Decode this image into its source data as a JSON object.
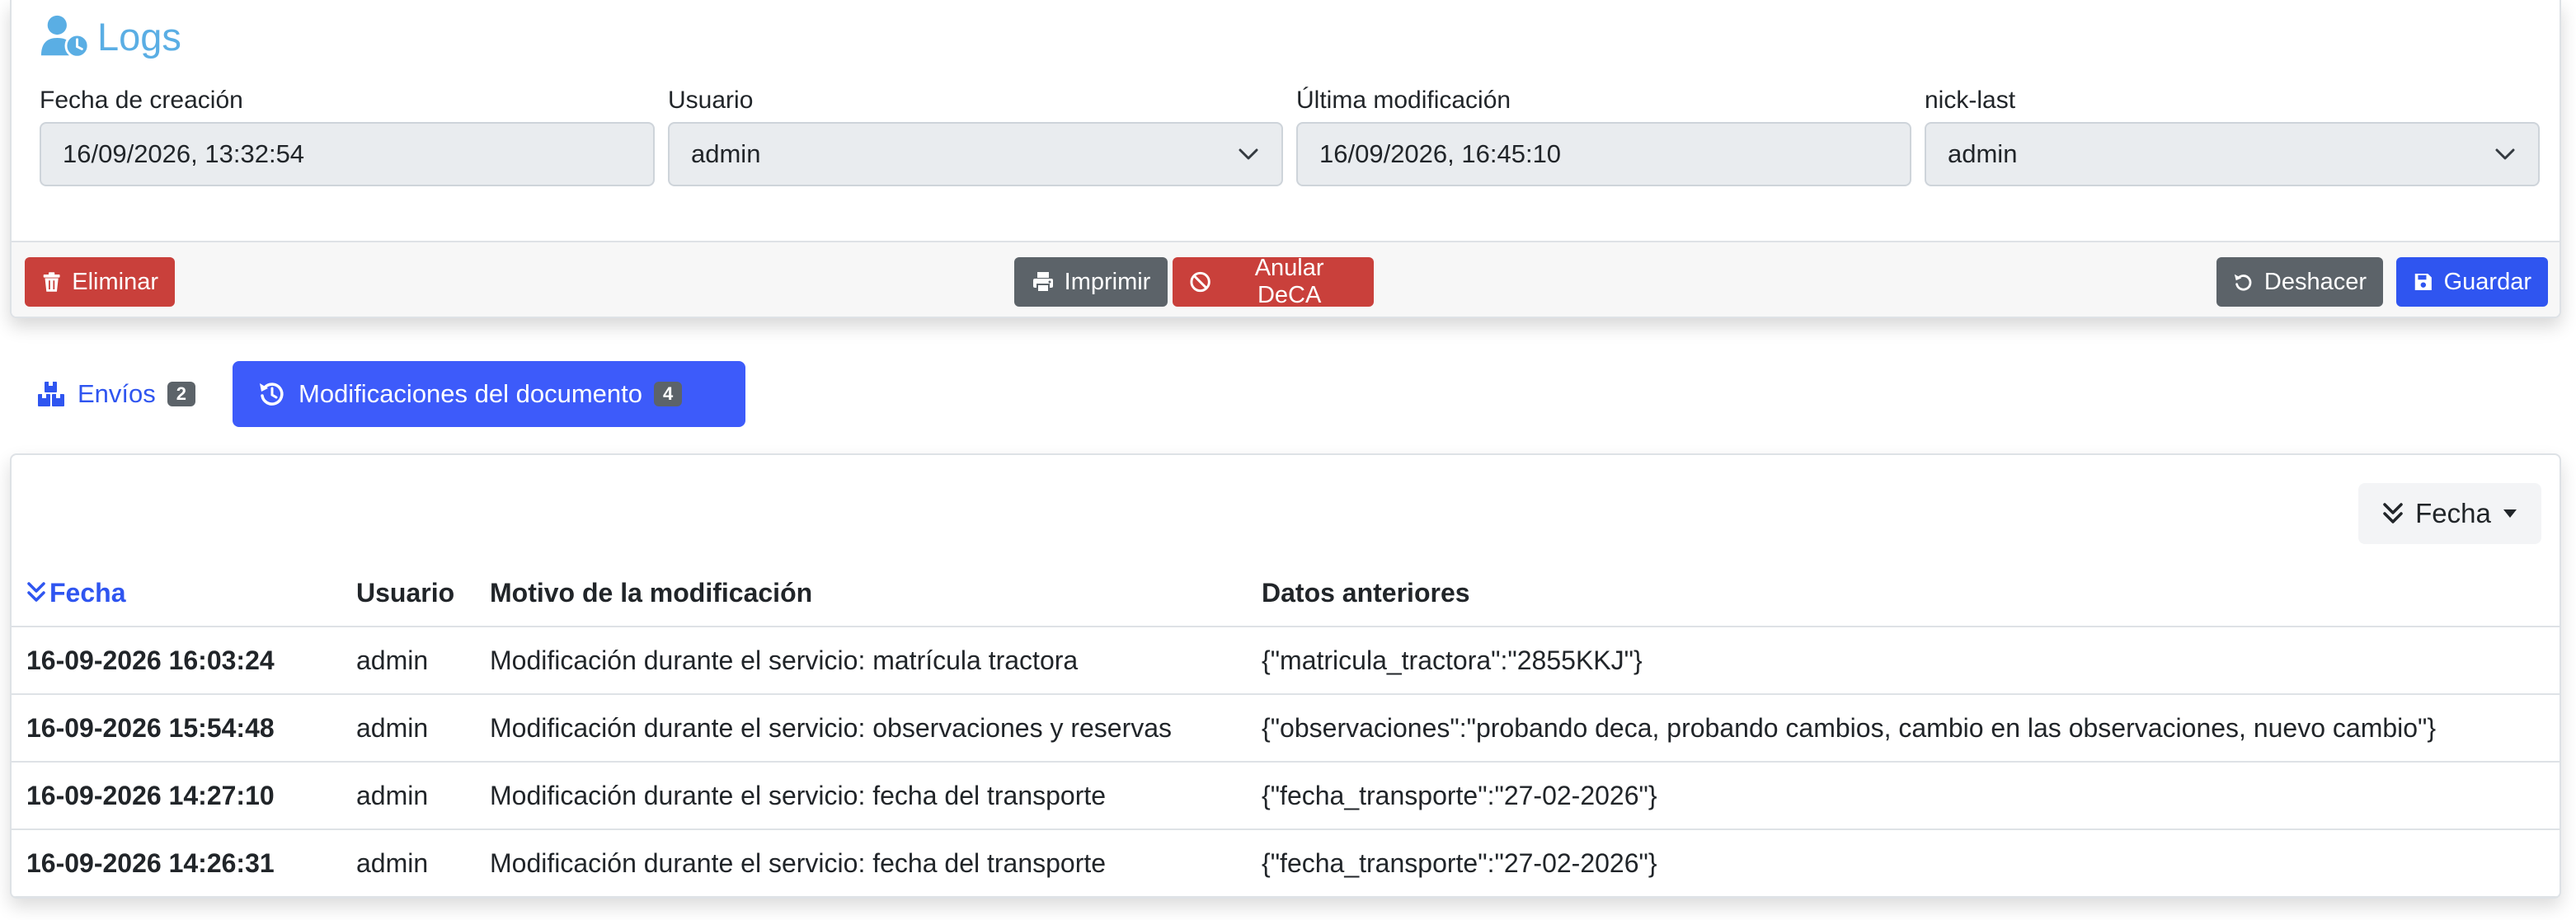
{
  "header": {
    "title": "Logs",
    "icon": "user-clock-icon",
    "accent_color": "#5aaee4"
  },
  "fields": {
    "created": {
      "label": "Fecha de creación",
      "value": "16/09/2026, 13:32:54"
    },
    "user": {
      "label": "Usuario",
      "value": "admin"
    },
    "modified": {
      "label": "Última modificación",
      "value": "16/09/2026, 16:45:10"
    },
    "nick_last": {
      "label": "nick-last",
      "value": "admin"
    }
  },
  "actions": {
    "delete": "Eliminar",
    "print": "Imprimir",
    "annul": "Anular DeCA",
    "undo": "Deshacer",
    "save": "Guardar"
  },
  "colors": {
    "danger": "#c9403b",
    "secondary": "#5c6369",
    "primary": "#2f55f0",
    "tab_active": "#3d5bfa"
  },
  "tabs": [
    {
      "label": "Envíos",
      "count": "2",
      "active": false,
      "icon": "boxes-icon"
    },
    {
      "label": "Modificaciones del documento",
      "count": "4",
      "active": true,
      "icon": "history-icon"
    }
  ],
  "sort": {
    "label": "Fecha"
  },
  "table": {
    "headers": [
      "Fecha",
      "Usuario",
      "Motivo de la modificación",
      "Datos anteriores"
    ],
    "rows": [
      [
        "16-09-2026 16:03:24",
        "admin",
        "Modificación durante el servicio: matrícula tractora",
        "{\"matricula_tractora\":\"2855KKJ\"}"
      ],
      [
        "16-09-2026 15:54:48",
        "admin",
        "Modificación durante el servicio: observaciones y reservas",
        "{\"observaciones\":\"probando deca, probando cambios, cambio en las observaciones, nuevo cambio\"}"
      ],
      [
        "16-09-2026 14:27:10",
        "admin",
        "Modificación durante el servicio: fecha del transporte",
        "{\"fecha_transporte\":\"27-02-2026\"}"
      ],
      [
        "16-09-2026 14:26:31",
        "admin",
        "Modificación durante el servicio: fecha del transporte",
        "{\"fecha_transporte\":\"27-02-2026\"}"
      ]
    ]
  }
}
